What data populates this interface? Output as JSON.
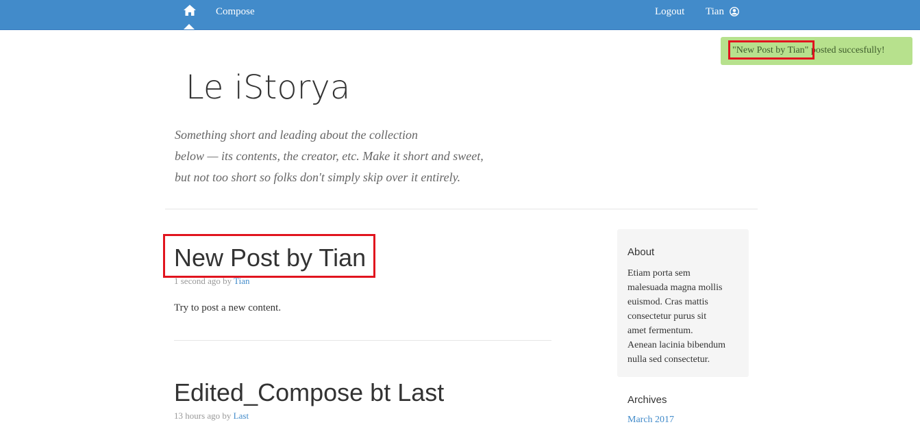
{
  "navbar": {
    "home_icon": "home-icon",
    "compose_label": "Compose",
    "logout_label": "Logout",
    "user_label": "Tian",
    "user_icon": "user-circle-icon",
    "background_color": "#428bca"
  },
  "alert": {
    "highlighted_text": "\"New Post by Tian\"",
    "message": "\"New Post by Tian\" posted succesfully!",
    "background_color": "#b7e18d",
    "highlight_color": "#e1141e"
  },
  "header": {
    "site_title": "Le iStorya",
    "lead_lines": [
      "Something short and leading about the collection",
      "below — its contents, the creator, etc. Make it short and sweet,",
      "but not too short so folks don't simply skip over it entirely."
    ]
  },
  "posts": [
    {
      "title": "New Post by Tian",
      "time": "1 second ago by ",
      "author": "Tian",
      "body": "Try to post a new content."
    },
    {
      "title": "Edited_Compose bt Last",
      "time": "13 hours ago by ",
      "author": "Last"
    }
  ],
  "sidebar": {
    "about_heading": "About",
    "about_lines": [
      "Etiam porta sem",
      "malesuada magna mollis",
      "euismod. Cras mattis",
      "consectetur purus sit",
      "amet fermentum.",
      "Aenean lacinia bibendum",
      "nulla sed consectetur."
    ],
    "archives_heading": "Archives",
    "archives": [
      "March 2017"
    ]
  }
}
